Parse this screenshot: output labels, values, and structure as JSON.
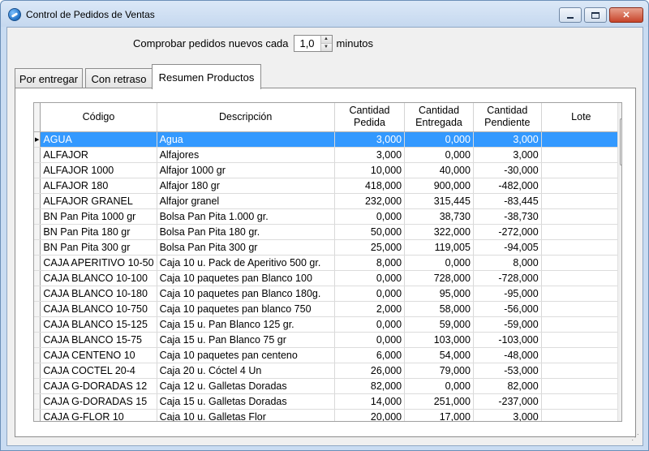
{
  "window": {
    "title": "Control de Pedidos de Ventas",
    "minimize_glyph": "min-icon",
    "maximize_glyph": "max-icon",
    "close_glyph": "✕"
  },
  "polling": {
    "label": "Comprobar pedidos nuevos cada",
    "value": "1,0",
    "unit": "minutos"
  },
  "tabs": [
    {
      "label": "Por entregar"
    },
    {
      "label": "Con retraso"
    },
    {
      "label": "Resumen Productos",
      "active": true
    }
  ],
  "grid": {
    "columns": [
      {
        "line1": "Código",
        "line2": ""
      },
      {
        "line1": "Descripción",
        "line2": ""
      },
      {
        "line1": "Cantidad",
        "line2": "Pedida"
      },
      {
        "line1": "Cantidad",
        "line2": "Entregada"
      },
      {
        "line1": "Cantidad",
        "line2": "Pendiente"
      },
      {
        "line1": "Lote",
        "line2": ""
      }
    ],
    "rows": [
      [
        "AGUA",
        "Agua",
        "3,000",
        "0,000",
        "3,000",
        ""
      ],
      [
        "ALFAJOR",
        "Alfajores",
        "3,000",
        "0,000",
        "3,000",
        ""
      ],
      [
        "ALFAJOR 1000",
        "Alfajor 1000 gr",
        "10,000",
        "40,000",
        "-30,000",
        ""
      ],
      [
        "ALFAJOR 180",
        "Alfajor 180 gr",
        "418,000",
        "900,000",
        "-482,000",
        ""
      ],
      [
        "ALFAJOR GRANEL",
        "Alfajor granel",
        "232,000",
        "315,445",
        "-83,445",
        ""
      ],
      [
        "BN Pan Pita 1000 gr",
        "Bolsa Pan Pita 1.000 gr.",
        "0,000",
        "38,730",
        "-38,730",
        ""
      ],
      [
        "BN Pan Pita 180 gr",
        "Bolsa Pan Pita 180 gr.",
        "50,000",
        "322,000",
        "-272,000",
        ""
      ],
      [
        "BN Pan Pita 300 gr",
        "Bolsa Pan Pita 300 gr",
        "25,000",
        "119,005",
        "-94,005",
        ""
      ],
      [
        "CAJA APERITIVO 10-50",
        "Caja 10 u. Pack de Aperitivo 500 gr.",
        "8,000",
        "0,000",
        "8,000",
        ""
      ],
      [
        "CAJA BLANCO 10-100",
        "Caja 10 paquetes pan Blanco 100",
        "0,000",
        "728,000",
        "-728,000",
        ""
      ],
      [
        "CAJA BLANCO 10-180",
        "Caja 10 paquetes pan Blanco 180g.",
        "0,000",
        "95,000",
        "-95,000",
        ""
      ],
      [
        "CAJA BLANCO 10-750",
        "Caja 10 paquetes pan blanco 750",
        "2,000",
        "58,000",
        "-56,000",
        ""
      ],
      [
        "CAJA BLANCO 15-125",
        "Caja 15 u. Pan Blanco 125 gr.",
        "0,000",
        "59,000",
        "-59,000",
        ""
      ],
      [
        "CAJA BLANCO 15-75",
        "Caja 15 u. Pan Blanco 75 gr",
        "0,000",
        "103,000",
        "-103,000",
        ""
      ],
      [
        "CAJA CENTENO 10",
        "Caja 10 paquetes pan centeno",
        "6,000",
        "54,000",
        "-48,000",
        ""
      ],
      [
        "CAJA COCTEL 20-4",
        "Caja 20 u. Cóctel 4 Un",
        "26,000",
        "79,000",
        "-53,000",
        ""
      ],
      [
        "CAJA G-DORADAS 12",
        "Caja 12 u. Galletas Doradas",
        "82,000",
        "0,000",
        "82,000",
        ""
      ],
      [
        "CAJA G-DORADAS 15",
        "Caja 15 u. Galletas Doradas",
        "14,000",
        "251,000",
        "-237,000",
        ""
      ],
      [
        "CAJA G-FLOR 10",
        "Caja 10 u. Galletas Flor",
        "20,000",
        "17,000",
        "3,000",
        ""
      ]
    ],
    "selected_row": 0
  },
  "colors": {
    "selection": "#3399ff",
    "titlebar": "#c5d8ef"
  }
}
